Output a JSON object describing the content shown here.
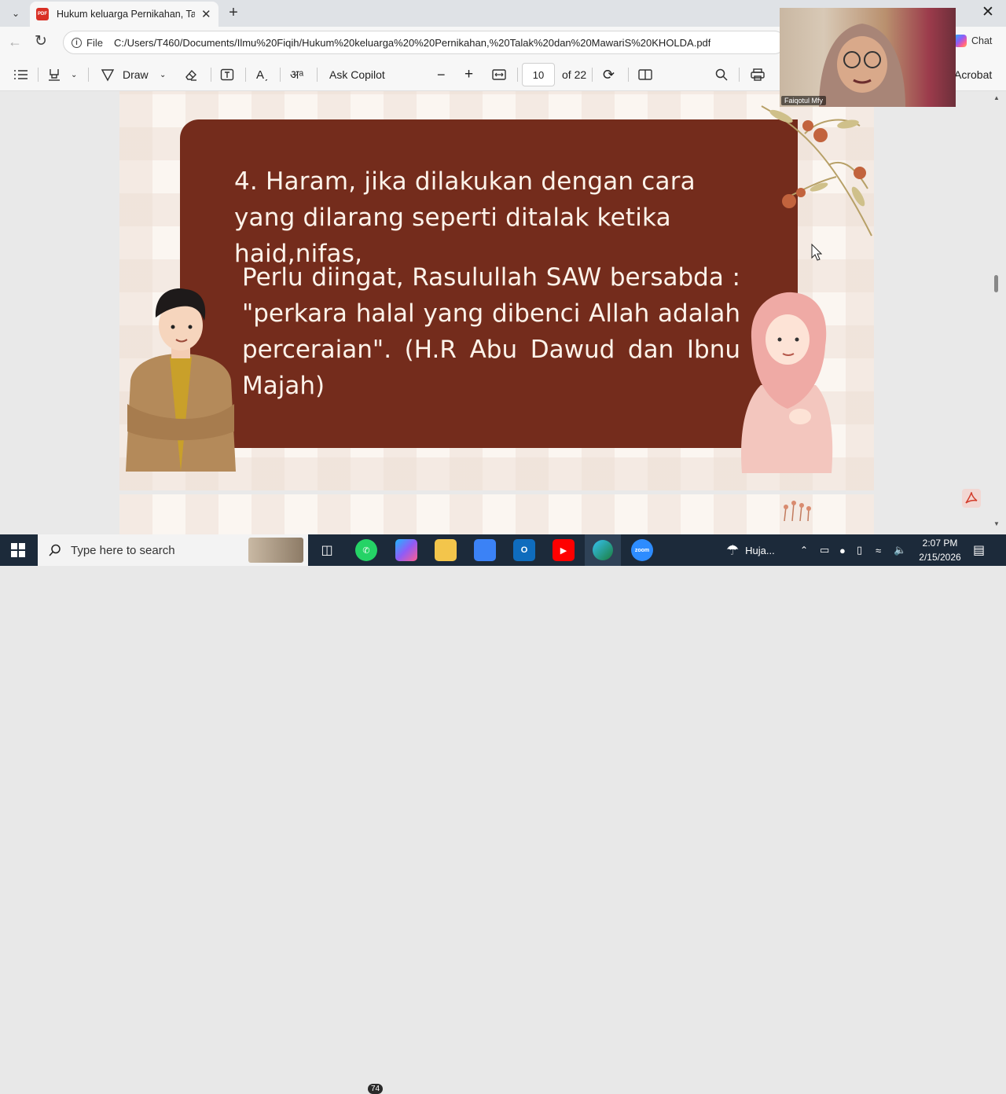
{
  "browser": {
    "tab_title": "Hukum keluarga Pernikahan, Talak",
    "pdf_favicon_label": "PDF",
    "address_prefix": "File",
    "address_url": "C:/Users/T460/Documents/Ilmu%20Fiqih/Hukum%20keluarga%20%20Pernikahan,%20Talak%20dan%20MawariS%20KHOLDA.pdf",
    "chat_label": "Chat"
  },
  "pdf_toolbar": {
    "draw_label": "Draw",
    "ask_copilot_label": "Ask Copilot",
    "page_number": "10",
    "page_total": "of 22",
    "acrobat_label": "Acrobat"
  },
  "slide": {
    "point_text": "4. Haram, jika dilakukan dengan cara yang dilarang seperti ditalak ketika haid,nifas,",
    "hadith_text": "Perlu diingat, Rasulullah SAW bersabda : \"perkara halal yang dibenci Allah adalah perceraian\". (H.R Abu Dawud dan Ibnu Majah)"
  },
  "webcam": {
    "participant_name": "Faiqotul Mfy"
  },
  "taskbar": {
    "search_placeholder": "Type here to search",
    "whatsapp_badge": "74",
    "weather_label": "Huja...",
    "time": "2:07 PM",
    "date": "2/15/2026"
  },
  "colors": {
    "slide_card": "#742c1c",
    "slide_text": "#fdf3ea",
    "taskbar": "#1c2a3a"
  }
}
